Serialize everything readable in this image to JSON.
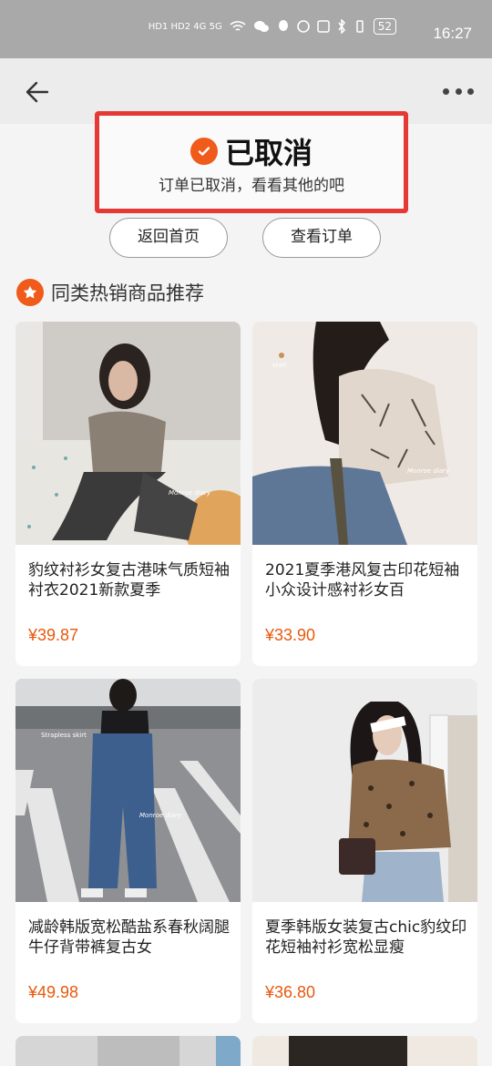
{
  "status_bar": {
    "signal_text": "HD1 HD2 4G 5G",
    "battery": "52",
    "time": "16:27"
  },
  "order_status": {
    "title": "已取消",
    "subtitle": "订单已取消，看看其他的吧"
  },
  "actions": {
    "home_label": "返回首页",
    "view_order_label": "查看订单"
  },
  "recommend": {
    "title": "同类热销商品推荐",
    "products": [
      {
        "name": "豹纹衬衫女复古港味气质短袖衬衣2021新款夏季",
        "price": "¥39.87",
        "watermark": "Monroe diary"
      },
      {
        "name": "2021夏季港风复古印花短袖小众设计感衬衫女百",
        "price": "¥33.90",
        "watermark": "Monroe diary",
        "tag": "shirt"
      },
      {
        "name": "减龄韩版宽松酷盐系春秋阔腿牛仔背带裤复古女",
        "price": "¥49.98",
        "watermark": "Monroe diary",
        "tag": "Strapless skirt"
      },
      {
        "name": "夏季韩版女装复古chic豹纹印花短袖衬衫宽松显瘦",
        "price": "¥36.80"
      }
    ]
  },
  "colors": {
    "accent": "#f05a1a",
    "price": "#e8590c",
    "highlight_border": "#e53935"
  }
}
